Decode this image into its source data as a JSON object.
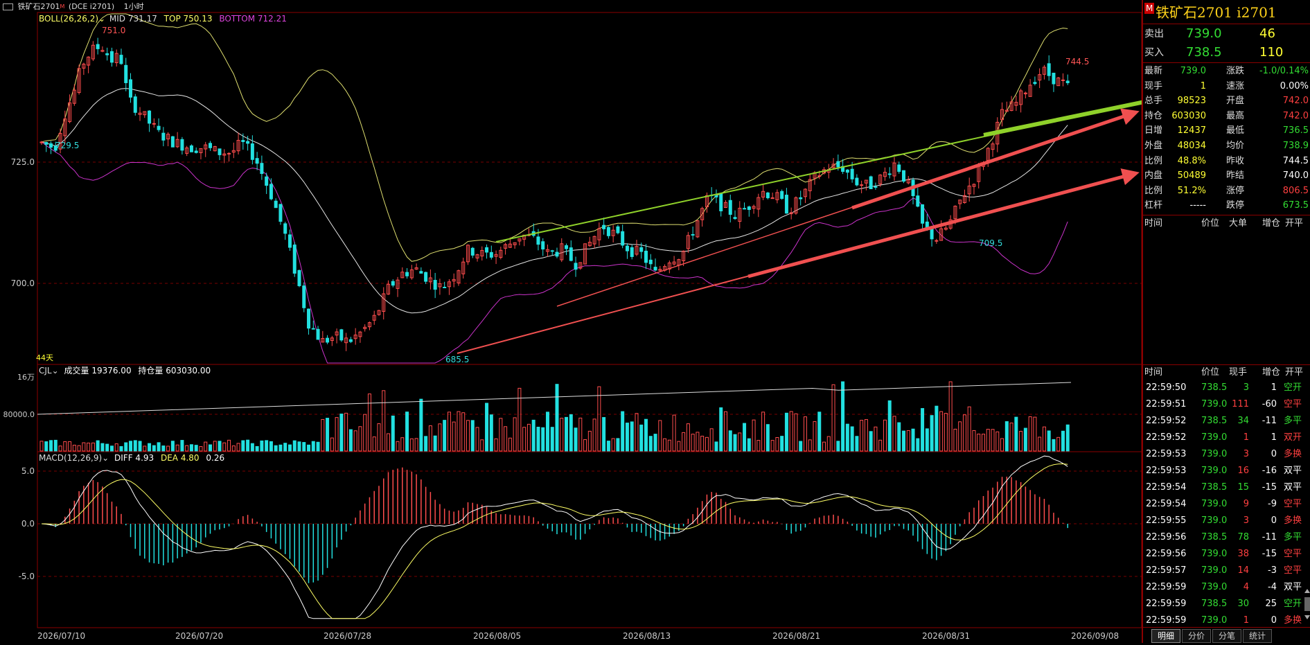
{
  "window": {
    "app_icon": "window-icon",
    "title": "铁矿石2701",
    "title_badge": "M",
    "code": "(DCE i2701)",
    "period": "1小时",
    "dropdown_icon": "chevron-down-icon"
  },
  "boll": {
    "label": "BOLL(26,26,2)",
    "mid": "MID 731.17",
    "top": "TOP 750.13",
    "bottom": "BOTTOM 712.21"
  },
  "price_axis": {
    "ticks": [
      "725.0",
      "700.0"
    ]
  },
  "price_marks": {
    "high": "751.0",
    "low1": "729.5",
    "low2": "685.5",
    "low3": "709.5",
    "high2": "744.5"
  },
  "day_count": "44天",
  "volume_panel": {
    "label": "CJL",
    "vol": "成交量 19376.00",
    "oi": "持仓量 603030.00",
    "axis": [
      "16万",
      "80000.0"
    ]
  },
  "macd_panel": {
    "label": "MACD(12,26,9)",
    "diff": "DIFF 4.93",
    "dea": "DEA 4.80",
    "macd": "0.26",
    "axis": [
      "5.0",
      "0.0",
      "-5.0"
    ]
  },
  "x_axis": [
    "2026/07/10",
    "2026/07/20",
    "2026/07/28",
    "2026/08/05",
    "2026/08/13",
    "2026/08/21",
    "2026/08/31",
    "2026/09/08"
  ],
  "right_panel": {
    "badge": "M",
    "title": "铁矿石2701  i2701",
    "ask_label": "卖出",
    "ask_price": "739.0",
    "ask_vol": "46",
    "bid_label": "买入",
    "bid_price": "738.5",
    "bid_vol": "110",
    "stats": [
      {
        "l1": "最新",
        "v1": "739.0",
        "c1": "green",
        "l2": "涨跌",
        "v2": "-1.0/0.14%",
        "c2": "green"
      },
      {
        "l1": "现手",
        "v1": "1",
        "c1": "yellow",
        "l2": "速涨",
        "v2": "0.00%",
        "c2": "white"
      },
      {
        "l1": "总手",
        "v1": "98523",
        "c1": "yellow",
        "l2": "开盘",
        "v2": "742.0",
        "c2": "red"
      },
      {
        "l1": "持仓",
        "v1": "603030",
        "c1": "yellow",
        "l2": "最高",
        "v2": "742.0",
        "c2": "red"
      },
      {
        "l1": "日增",
        "v1": "12437",
        "c1": "yellow",
        "l2": "最低",
        "v2": "736.5",
        "c2": "green"
      },
      {
        "l1": "外盘",
        "v1": "48034",
        "c1": "yellow",
        "l2": "均价",
        "v2": "738.9",
        "c2": "green"
      },
      {
        "l1": "比例",
        "v1": "48.8%",
        "c1": "yellow",
        "l2": "昨收",
        "v2": "744.5",
        "c2": "white"
      },
      {
        "l1": "内盘",
        "v1": "50489",
        "c1": "yellow",
        "l2": "昨结",
        "v2": "740.0",
        "c2": "white"
      },
      {
        "l1": "比例",
        "v1": "51.2%",
        "c1": "yellow",
        "l2": "涨停",
        "v2": "806.5",
        "c2": "red"
      },
      {
        "l1": "杠杆",
        "v1": "-----",
        "c1": "white",
        "l2": "跌停",
        "v2": "673.5",
        "c2": "green"
      }
    ],
    "upper_headers": [
      "时间",
      "价位",
      "大单",
      "增仓",
      "开平"
    ],
    "tick_headers": [
      "时间",
      "价位",
      "现手",
      "增仓",
      "开平"
    ],
    "ticks": [
      {
        "t": "22:59:50",
        "p": "738.5",
        "pc": "green",
        "v": "3",
        "vc": "green",
        "oi": "1",
        "kind": "空开",
        "kc": "green"
      },
      {
        "t": "22:59:51",
        "p": "739.0",
        "pc": "green",
        "v": "111",
        "vc": "red",
        "oi": "-60",
        "kind": "空平",
        "kc": "red"
      },
      {
        "t": "22:59:52",
        "p": "738.5",
        "pc": "green",
        "v": "34",
        "vc": "green",
        "oi": "-11",
        "kind": "多平",
        "kc": "green"
      },
      {
        "t": "22:59:52",
        "p": "739.0",
        "pc": "green",
        "v": "1",
        "vc": "red",
        "oi": "1",
        "kind": "双开",
        "kc": "red"
      },
      {
        "t": "22:59:53",
        "p": "739.0",
        "pc": "green",
        "v": "3",
        "vc": "red",
        "oi": "0",
        "kind": "多换",
        "kc": "red"
      },
      {
        "t": "22:59:53",
        "p": "739.0",
        "pc": "green",
        "v": "16",
        "vc": "red",
        "oi": "-16",
        "kind": "双平",
        "kc": "white"
      },
      {
        "t": "22:59:54",
        "p": "738.5",
        "pc": "green",
        "v": "15",
        "vc": "green",
        "oi": "-15",
        "kind": "双平",
        "kc": "white"
      },
      {
        "t": "22:59:54",
        "p": "739.0",
        "pc": "green",
        "v": "9",
        "vc": "red",
        "oi": "-9",
        "kind": "空平",
        "kc": "red"
      },
      {
        "t": "22:59:55",
        "p": "739.0",
        "pc": "green",
        "v": "3",
        "vc": "red",
        "oi": "0",
        "kind": "多换",
        "kc": "red"
      },
      {
        "t": "22:59:56",
        "p": "738.5",
        "pc": "green",
        "v": "78",
        "vc": "green",
        "oi": "-11",
        "kind": "多平",
        "kc": "green"
      },
      {
        "t": "22:59:56",
        "p": "739.0",
        "pc": "green",
        "v": "38",
        "vc": "red",
        "oi": "-15",
        "kind": "空平",
        "kc": "red"
      },
      {
        "t": "22:59:57",
        "p": "739.0",
        "pc": "green",
        "v": "14",
        "vc": "red",
        "oi": "-3",
        "kind": "空平",
        "kc": "red"
      },
      {
        "t": "22:59:59",
        "p": "739.0",
        "pc": "green",
        "v": "4",
        "vc": "red",
        "oi": "-4",
        "kind": "双平",
        "kc": "white"
      },
      {
        "t": "22:59:59",
        "p": "738.5",
        "pc": "green",
        "v": "30",
        "vc": "green",
        "oi": "25",
        "kind": "空开",
        "kc": "green"
      },
      {
        "t": "22:59:59",
        "p": "739.0",
        "pc": "green",
        "v": "1",
        "vc": "red",
        "oi": "0",
        "kind": "多换",
        "kc": "red"
      }
    ],
    "tabs": [
      "明细",
      "分价",
      "分笔",
      "统计"
    ],
    "scroll_icon": "scroll-arrow-icon"
  },
  "colors": {
    "up": "#ff4d4d",
    "down": "#22e0e0",
    "boll_mid": "#e6e6e6",
    "boll_top": "#e0e070",
    "boll_bottom": "#cc33cc",
    "trend_green": "#8fd12a",
    "trend_red": "#f05050",
    "grid": "#5a0000"
  }
}
